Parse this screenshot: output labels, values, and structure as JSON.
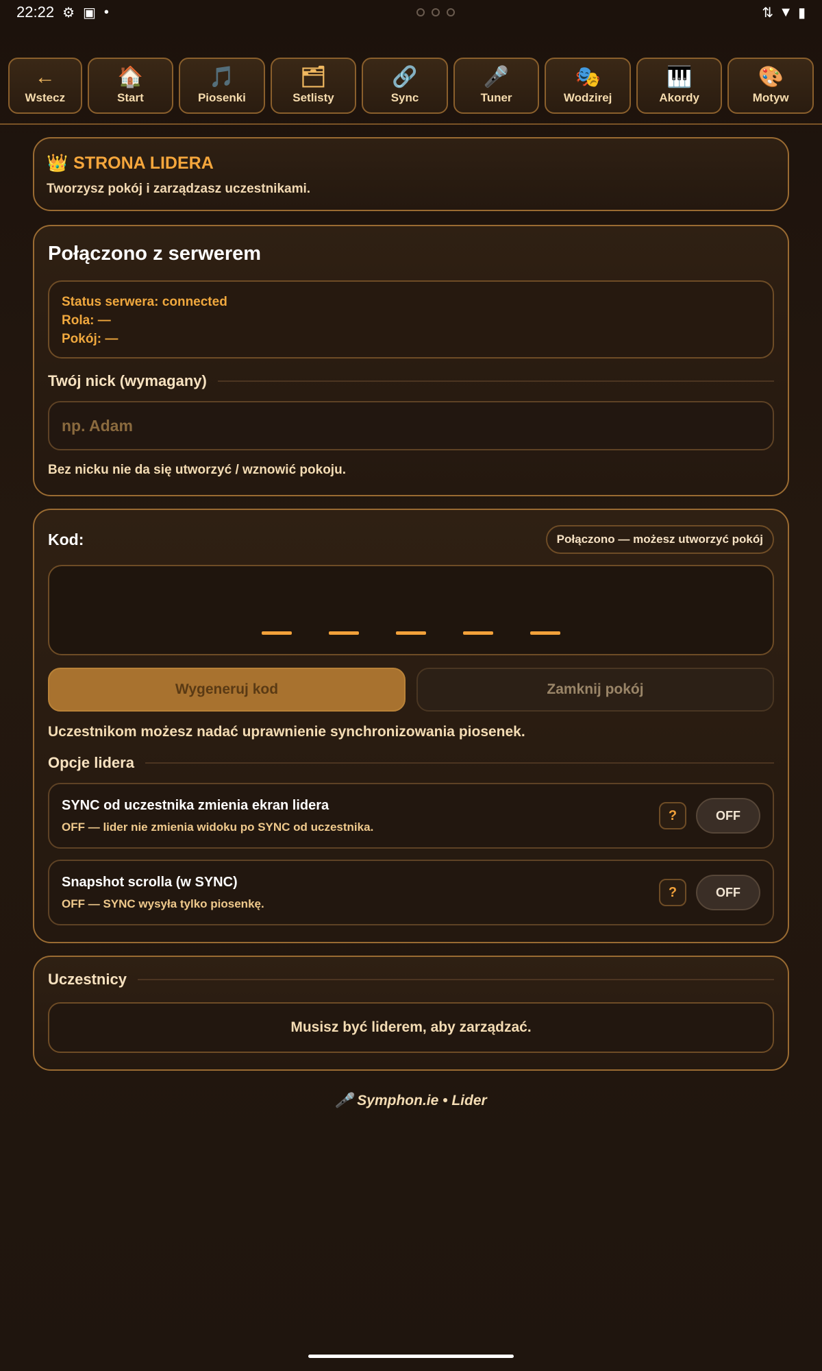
{
  "status_bar": {
    "time": "22:22",
    "icons": [
      "gear-icon",
      "folder-icon",
      "dot-icon"
    ],
    "right_icons": [
      "signal-icon",
      "wifi-icon",
      "battery-icon"
    ]
  },
  "nav": {
    "back": {
      "glyph": "←",
      "label": "Wstecz"
    },
    "items": [
      {
        "glyph": "🏠",
        "label": "Start"
      },
      {
        "glyph": "🎵",
        "label": "Piosenki"
      },
      {
        "glyph": "🗂",
        "label": "Setlisty"
      },
      {
        "glyph": "🔗",
        "label": "Sync"
      },
      {
        "glyph": "🎤",
        "label": "Tuner"
      },
      {
        "glyph": "🎭",
        "label": "Wodzirej"
      },
      {
        "glyph": "🎹",
        "label": "Akordy"
      },
      {
        "glyph": "🎨",
        "label": "Motyw"
      }
    ]
  },
  "leader": {
    "icon": "👑",
    "title": "STRONA LIDERA",
    "subtitle": "Tworzysz pokój i zarządzasz uczestnikami."
  },
  "server": {
    "title": "Połączono z serwerem",
    "status_line": "Status serwera: connected",
    "role_line": "Rola: —",
    "room_line": "Pokój: —",
    "nick_heading": "Twój nick (wymagany)",
    "nick_placeholder": "np. Adam",
    "nick_value": "",
    "nick_hint": "Bez nicku nie da się utworzyć / wznowić pokoju."
  },
  "code": {
    "label": "Kod:",
    "status_pill": "Połączono — możesz utworzyć pokój",
    "digits": [
      "",
      "",
      "",
      "",
      ""
    ],
    "generate_button": "Wygeneruj kod",
    "close_button": "Zamknij pokój",
    "permission_text": "Uczestnikom możesz nadać uprawnienie synchronizowania piosenek.",
    "options_heading": "Opcje lidera",
    "options": [
      {
        "title": "SYNC od uczestnika zmienia ekran lidera",
        "subtitle": "OFF — lider nie zmienia widoku po SYNC od uczestnika.",
        "help": "?",
        "toggle": "OFF"
      },
      {
        "title": "Snapshot scrolla (w SYNC)",
        "subtitle": "OFF — SYNC wysyła tylko piosenkę.",
        "help": "?",
        "toggle": "OFF"
      }
    ]
  },
  "participants": {
    "heading": "Uczestnicy",
    "message": "Musisz być liderem, aby zarządzać."
  },
  "footer": {
    "icon": "🎤",
    "text": "Symphon.ie • Lider"
  }
}
